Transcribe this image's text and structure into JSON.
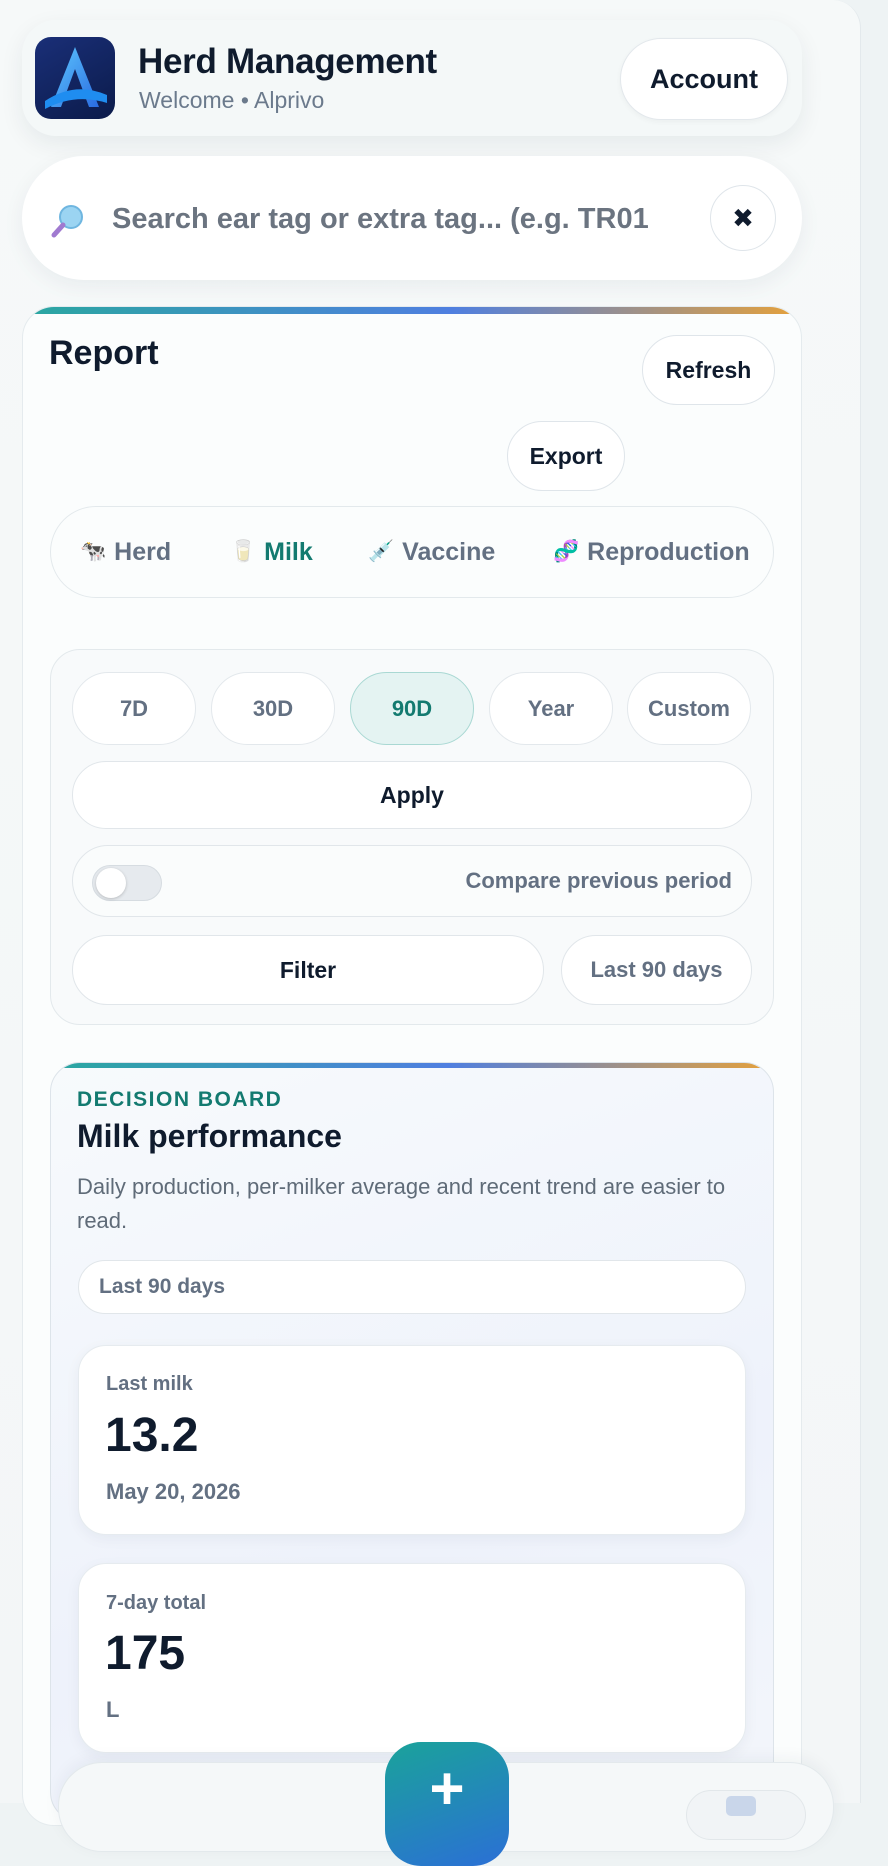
{
  "header": {
    "title": "Herd Management",
    "subtitle": "Welcome • Alprivo",
    "account_label": "Account"
  },
  "search": {
    "placeholder": "Search ear tag or extra tag... (e.g. TR01",
    "clear_label": "✖"
  },
  "report": {
    "title": "Report",
    "refresh_label": "Refresh",
    "export_label": "Export",
    "tabs": [
      {
        "label": "Herd",
        "icon": "🐄",
        "active": false
      },
      {
        "label": "Milk",
        "icon": "🥛",
        "active": true
      },
      {
        "label": "Vaccine",
        "icon": "💉",
        "active": false
      },
      {
        "label": "Reproduction",
        "icon": "🧬",
        "active": false
      }
    ],
    "periods": [
      {
        "label": "7D",
        "active": false
      },
      {
        "label": "30D",
        "active": false
      },
      {
        "label": "90D",
        "active": true
      },
      {
        "label": "Year",
        "active": false
      },
      {
        "label": "Custom",
        "active": false
      }
    ],
    "apply_label": "Apply",
    "compare_label": "Compare previous period",
    "compare_enabled": false,
    "filter_label": "Filter",
    "range_label": "Last 90 days"
  },
  "board": {
    "eyebrow": "DECISION BOARD",
    "title": "Milk performance",
    "description": "Daily production, per-milker average and recent trend are easier to read.",
    "range_chip": "Last 90 days",
    "stats": [
      {
        "label": "Last milk",
        "value": "13.2",
        "sub": "May 20, 2026"
      },
      {
        "label": "7-day total",
        "value": "175",
        "sub": "L"
      }
    ]
  },
  "bottom": {
    "fab_label": "+"
  },
  "colors": {
    "accent": "#137a70",
    "brand_blue": "#2b6fd6",
    "text_dark": "#0f1b2d",
    "text_muted": "#637082"
  }
}
